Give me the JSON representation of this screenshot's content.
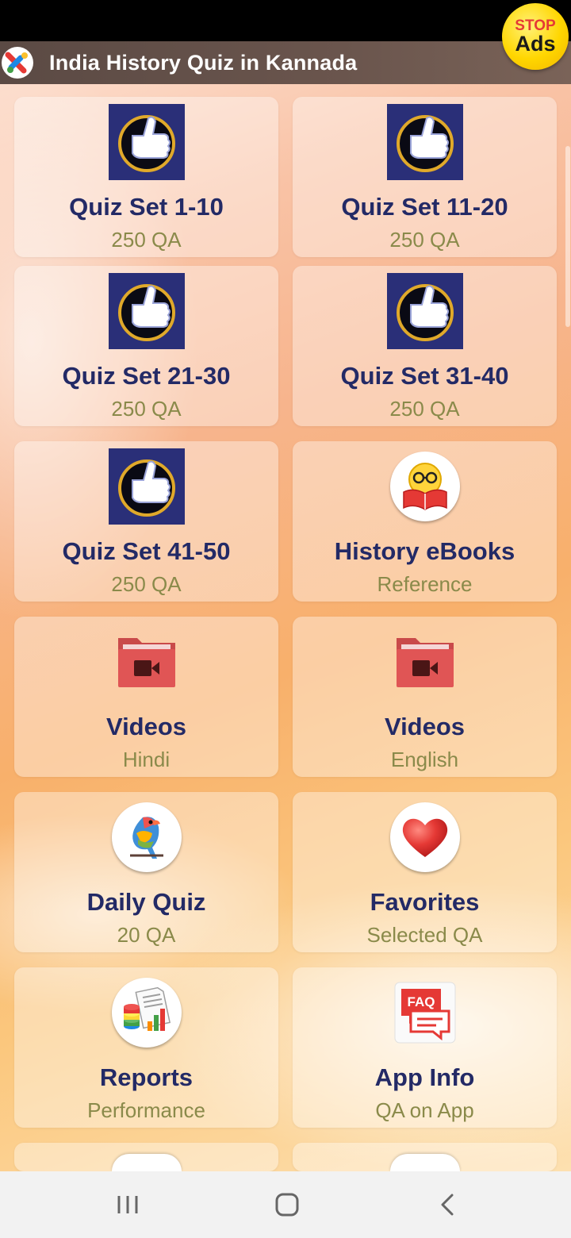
{
  "app_bar": {
    "title": "India History Quiz in Kannada"
  },
  "stop_ads": {
    "line1": "STOP",
    "line2": "Ads"
  },
  "tiles": [
    {
      "icon": "thumbs-up-icon",
      "title": "Quiz Set 1-10",
      "subtitle": "250 QA"
    },
    {
      "icon": "thumbs-up-icon",
      "title": "Quiz Set 11-20",
      "subtitle": "250 QA"
    },
    {
      "icon": "thumbs-up-icon",
      "title": "Quiz Set 21-30",
      "subtitle": "250 QA"
    },
    {
      "icon": "thumbs-up-icon",
      "title": "Quiz Set 31-40",
      "subtitle": "250 QA"
    },
    {
      "icon": "thumbs-up-icon",
      "title": "Quiz Set 41-50",
      "subtitle": "250 QA"
    },
    {
      "icon": "reading-book-icon",
      "title": "History eBooks",
      "subtitle": "Reference"
    },
    {
      "icon": "video-folder-icon",
      "title": "Videos",
      "subtitle": "Hindi"
    },
    {
      "icon": "video-folder-icon",
      "title": "Videos",
      "subtitle": "English"
    },
    {
      "icon": "parrot-icon",
      "title": "Daily Quiz",
      "subtitle": "20 QA"
    },
    {
      "icon": "heart-icon",
      "title": "Favorites",
      "subtitle": "Selected QA"
    },
    {
      "icon": "report-chart-icon",
      "title": "Reports",
      "subtitle": "Performance"
    },
    {
      "icon": "faq-icon",
      "title": "App Info",
      "subtitle": "QA on App",
      "icon_text": "FAQ"
    }
  ],
  "colors": {
    "tile_title": "#232a66",
    "tile_subtitle": "#8a8a4a",
    "app_bar": "#5b4a44"
  }
}
